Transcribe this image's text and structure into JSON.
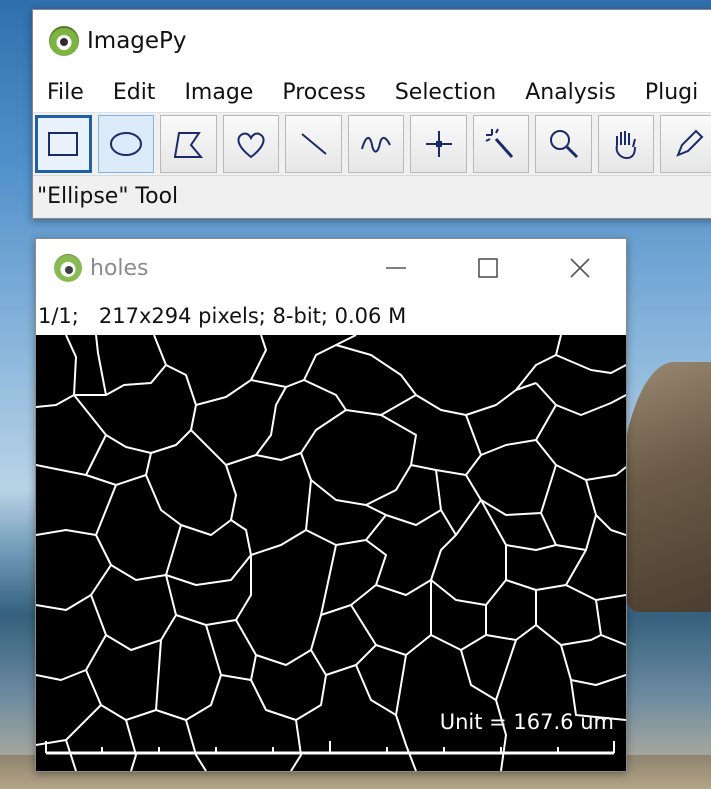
{
  "app": {
    "title": "ImagePy",
    "status": "\"Ellipse\" Tool"
  },
  "menu": [
    "File",
    "Edit",
    "Image",
    "Process",
    "Selection",
    "Analysis",
    "Plugi"
  ],
  "tools": [
    {
      "name": "rectangle-tool",
      "icon": "rectangle-icon",
      "state": "active"
    },
    {
      "name": "ellipse-tool",
      "icon": "ellipse-icon",
      "state": "selected"
    },
    {
      "name": "polygon-tool",
      "icon": "polygon-icon",
      "state": ""
    },
    {
      "name": "freehand-tool",
      "icon": "heart-icon",
      "state": ""
    },
    {
      "name": "line-tool",
      "icon": "line-icon",
      "state": ""
    },
    {
      "name": "freeline-tool",
      "icon": "wave-icon",
      "state": ""
    },
    {
      "name": "point-tool",
      "icon": "crosshair-icon",
      "state": ""
    },
    {
      "name": "magic-wand-tool",
      "icon": "magic-wand-icon",
      "state": ""
    },
    {
      "name": "zoom-tool",
      "icon": "magnifier-icon",
      "state": ""
    },
    {
      "name": "hand-tool",
      "icon": "hand-icon",
      "state": ""
    },
    {
      "name": "pencil-tool",
      "icon": "pencil-icon",
      "state": ""
    }
  ],
  "image_window": {
    "title": "holes",
    "info": "1/1;   217x294 pixels; 8-bit; 0.06 M",
    "scale_label": "Unit = 167.6 um"
  },
  "colors": {
    "accent": "#1f5fa8",
    "canvas": "#000000",
    "lines": "#ffffff"
  }
}
